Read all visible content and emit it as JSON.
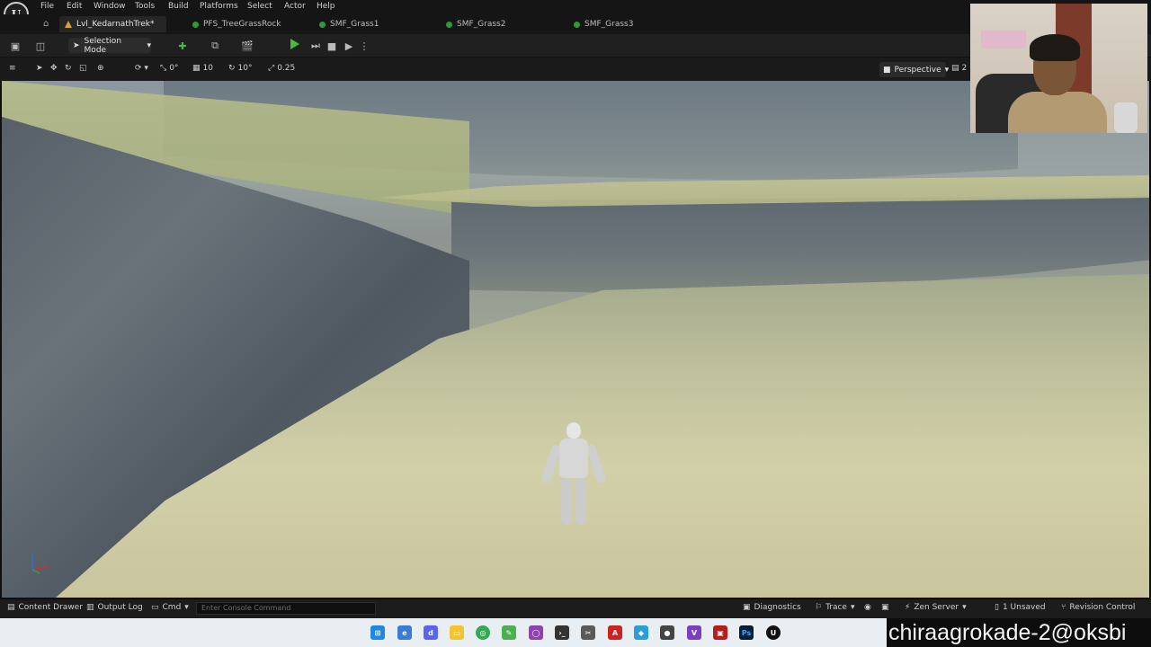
{
  "menubar": {
    "items": [
      "File",
      "Edit",
      "Window",
      "Tools",
      "Build",
      "Platforms",
      "Select",
      "Actor",
      "Help"
    ]
  },
  "tabs": [
    {
      "label": "Lvl_KedarnathTrek*",
      "active": true
    },
    {
      "label": "PFS_TreeGrassRock",
      "active": false
    },
    {
      "label": "SMF_Grass1",
      "active": false
    },
    {
      "label": "SMF_Grass2",
      "active": false
    },
    {
      "label": "SMF_Grass3",
      "active": false
    }
  ],
  "toolbar": {
    "selection_mode": "Selection Mode"
  },
  "viewport_toolbar": {
    "rotation_snap": "0°",
    "grid_snap": "10",
    "angle_snap": "10°",
    "scale_snap": "0.25",
    "view_mode": "Perspective",
    "camera_speed": "2"
  },
  "statusbar": {
    "content_drawer": "Content Drawer",
    "output_log": "Output Log",
    "cmd": "Cmd",
    "console_placeholder": "Enter Console Command",
    "diagnostics": "Diagnostics",
    "trace": "Trace",
    "zen_server": "Zen Server",
    "unsaved": "1 Unsaved",
    "revision_control": "Revision Control"
  },
  "watermark": "chiraagrokade-2@oksbi",
  "colors": {
    "accent_green": "#3fbf3a",
    "tab_dot": "#2e9b3a",
    "warning": "#d9a13a"
  }
}
